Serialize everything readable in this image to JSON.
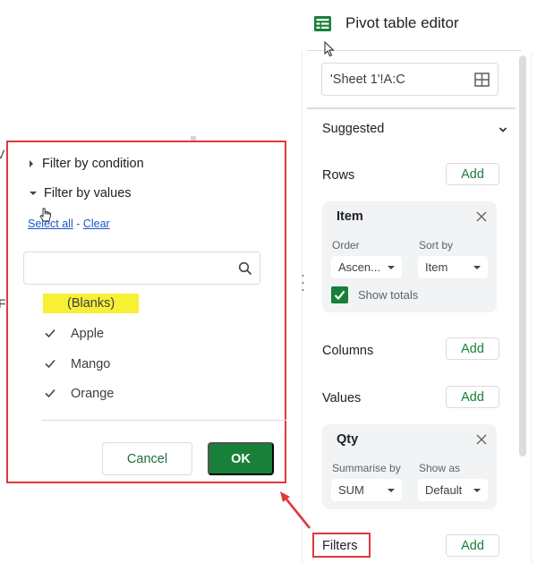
{
  "background_sheet": {
    "fragments": [
      "V",
      "Fi"
    ]
  },
  "filter_popup": {
    "filter_by_condition": "Filter by condition",
    "filter_by_values": "Filter by values",
    "select_all": "Select all",
    "separator": " - ",
    "clear": "Clear",
    "search": {
      "value": "",
      "placeholder": "",
      "icon": "search-icon"
    },
    "values": [
      {
        "label": "(Blanks)",
        "checked": false,
        "highlighted": true,
        "highlight_color": "#f7f035"
      },
      {
        "label": "Apple",
        "checked": true
      },
      {
        "label": "Mango",
        "checked": true
      },
      {
        "label": "Orange",
        "checked": true
      }
    ],
    "cancel_label": "Cancel",
    "ok_label": "OK",
    "annotation_border_color": "#e0393e"
  },
  "pivot_editor": {
    "title": "Pivot table editor",
    "icon": "sheets-icon",
    "range": "'Sheet 1'!A:C",
    "range_icon": "grid-select-icon",
    "suggested_label": "Suggested",
    "rows": {
      "label": "Rows",
      "add_label": "Add",
      "card": {
        "title": "Item",
        "order_label": "Order",
        "order_value": "Ascen...",
        "sort_by_label": "Sort by",
        "sort_by_value": "Item",
        "show_totals_label": "Show totals",
        "show_totals_checked": true
      }
    },
    "columns": {
      "label": "Columns",
      "add_label": "Add"
    },
    "values": {
      "label": "Values",
      "add_label": "Add",
      "card": {
        "title": "Qty",
        "summarise_by_label": "Summarise by",
        "summarise_by_value": "SUM",
        "show_as_label": "Show as",
        "show_as_value": "Default"
      }
    },
    "filters": {
      "label": "Filters",
      "add_label": "Add"
    },
    "accent_color": "#188038"
  }
}
